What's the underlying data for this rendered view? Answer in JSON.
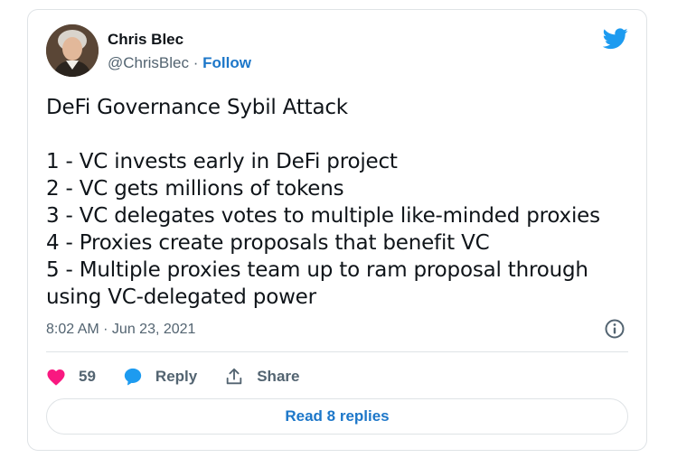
{
  "author": {
    "name": "Chris Blec",
    "handle": "@ChrisBlec",
    "separator": " · ",
    "follow_label": "Follow"
  },
  "tweet": {
    "title": "DeFi Governance Sybil Attack",
    "lines": [
      "1 - VC invests early in DeFi project",
      "2 - VC gets millions of tokens",
      "3 - VC delegates votes to multiple like-minded proxies",
      "4 - Proxies create proposals that benefit VC",
      "5 - Multiple proxies team up to ram proposal through",
      "using VC-delegated power"
    ],
    "timestamp": "8:02 AM · Jun 23, 2021"
  },
  "actions": {
    "like_count": "59",
    "reply_label": "Reply",
    "share_label": "Share"
  },
  "replies_button": "Read 8 replies",
  "icons": {
    "brand": "twitter-bird-icon",
    "info": "info-icon",
    "like": "heart-icon",
    "reply": "speech-bubble-icon",
    "share": "share-arrow-icon"
  },
  "colors": {
    "twitter_blue": "#1d9bf0",
    "link_blue": "#1d77c9",
    "like_pink": "#f91880",
    "text_primary": "#0f1419",
    "text_secondary": "#536471",
    "border": "#dfe3e6"
  }
}
